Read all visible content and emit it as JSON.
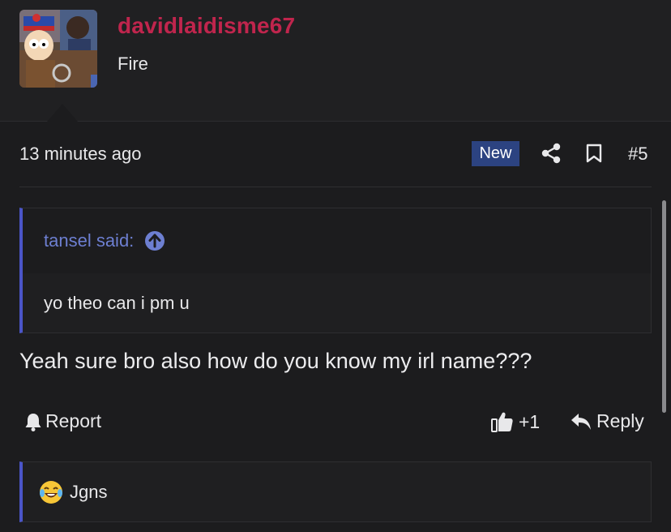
{
  "post": {
    "username": "davidlaidisme67",
    "user_title": "Fire",
    "timestamp": "13 minutes ago",
    "new_badge": "New",
    "post_number": "#5",
    "quote": {
      "author": "tansel said:",
      "text": "yo theo can i pm u"
    },
    "message": "Yeah sure bro also how do you know my irl name???",
    "actions": {
      "report": "Report",
      "like_count": "+1",
      "reply": "Reply"
    },
    "reactions_text": "Jgns"
  },
  "icons": {
    "share": "share-icon",
    "bookmark": "bookmark-icon",
    "quote_jump": "arrow-up-circle-icon",
    "report": "bell-icon",
    "like": "thumbs-up-icon",
    "reply": "reply-arrow-icon",
    "reaction": "joy-emoji-icon"
  },
  "colors": {
    "username": "#c0254d",
    "accent": "#4a55c8",
    "quote_author": "#6d7fd1",
    "new_badge": "#2c4381",
    "background": "#1c1c1e"
  }
}
